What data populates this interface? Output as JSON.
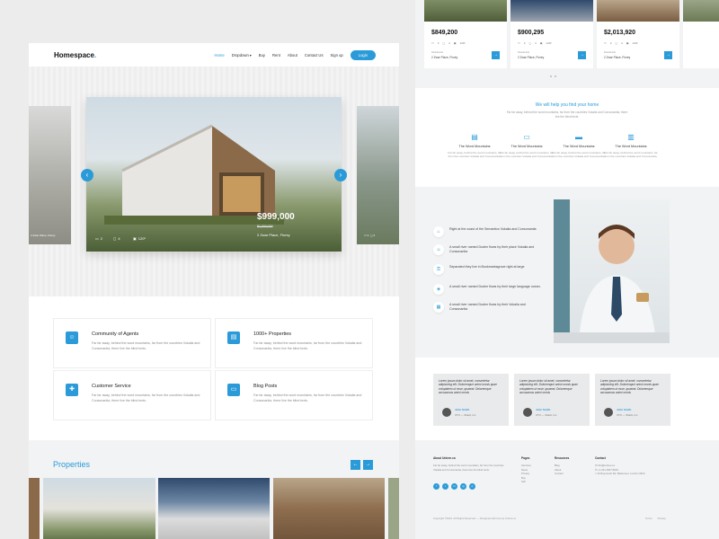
{
  "colors": {
    "accent": "#2a9bd8",
    "text": "#222222",
    "muted": "#888888",
    "band": "#f2f3f4"
  },
  "nav": {
    "logo": "Homespace",
    "logo_dot": ".",
    "items": [
      {
        "label": "Home",
        "active": true
      },
      {
        "label": "Dropdown",
        "caret": true
      },
      {
        "label": "Buy"
      },
      {
        "label": "Rent"
      },
      {
        "label": "About"
      },
      {
        "label": "Contact Us"
      },
      {
        "label": "Sign up"
      }
    ],
    "login": "Login"
  },
  "hero": {
    "price": "$999,000",
    "old_price": "$1,000,000",
    "address": "2 Zwar Place, Florey",
    "beds": "2",
    "baths": "4",
    "area": "120²",
    "prev_icon": "chevron-left-icon",
    "next_icon": "chevron-right-icon"
  },
  "services": [
    {
      "title": "Community of Agents",
      "text": "Far far away, behind the word mountains, far from the countries Vokalia and Consonantia, there live the blind texts.",
      "icon": "people-icon"
    },
    {
      "title": "1000+ Properties",
      "text": "Far far away, behind the word mountains, far from the countries Vokalia and Consonantia, there live the blind texts.",
      "icon": "building-icon"
    },
    {
      "title": "Customer Service",
      "text": "Far far away, behind the word mountains, far from the countries Vokalia and Consonantia, there live the blind texts.",
      "icon": "lifebuoy-icon"
    },
    {
      "title": "Blog Posts",
      "text": "Far far away, behind the word mountains, far from the countries Vokalia and Consonantia, there live the blind texts.",
      "icon": "chat-icon"
    }
  ],
  "properties": {
    "title": "Properties"
  },
  "listings": [
    {
      "price": "$849,200",
      "beds": "2",
      "baths": "4",
      "area": "120²",
      "small": "Residential",
      "address": "2 Zwar Place, Florey"
    },
    {
      "price": "$900,295",
      "beds": "2",
      "baths": "4",
      "area": "120²",
      "small": "Residential",
      "address": "2 Zwar Place, Florey"
    },
    {
      "price": "$2,013,920",
      "beds": "2",
      "baths": "4",
      "area": "120²",
      "small": "Residential",
      "address": "2 Zwar Place, Florey"
    }
  ],
  "help": {
    "title": "We will help you find your home",
    "subtitle": "Far far away, behind the word mountains, far from the countries Vokalia and Consonantia, there live the blind texts.",
    "cols": [
      {
        "title": "The Word Mountains",
        "text": "Far far away, behind the word mountains, far from the countries Vokalia and Consonantia.",
        "icon": "document-icon"
      },
      {
        "title": "The Word Mountains",
        "text": "Far far away, behind the word mountains, far from the countries Vokalia and Consonantia.",
        "icon": "couch-icon"
      },
      {
        "title": "The Word Mountains",
        "text": "Far far away, behind the word mountains, far from the countries Vokalia and Consonantia.",
        "icon": "bed-icon"
      },
      {
        "title": "The Word Mountains",
        "text": "Far far away, behind the word mountains, far from the countries Vokalia and Consonantia.",
        "icon": "building-icon"
      }
    ]
  },
  "agent_features": [
    {
      "text": "Right at the coast of the Semantics Vokalia and Consonantia",
      "icon": "home-icon"
    },
    {
      "text": "A small river named Duden flows by their place Vokalia and Consonantia",
      "icon": "people-icon"
    },
    {
      "text": "Separated they live in Bookmarksgrove right at large",
      "icon": "key-icon"
    },
    {
      "text": "A small river named Duden flows by their large language ocean.",
      "icon": "map-icon"
    },
    {
      "text": "A small river named Duden flows by their Vokalia and Consonantia",
      "icon": "chart-icon"
    }
  ],
  "testimonials": [
    {
      "quote": "Lorem ipsum dolor sit amet, consectetur adipisicing elit. Doloremque animi omnis quae voluptatem ut esse, quaerat. Doloremque accusamus animi omnis",
      "name": "John Smith",
      "role": "CTO — Shack, Inc."
    },
    {
      "quote": "Lorem ipsum dolor sit amet, consectetur adipisicing elit. Doloremque animi omnis quae voluptatem ut esse, quaerat. Doloremque accusamus animi omnis",
      "name": "John Smith",
      "role": "CTO — Shack, Inc."
    },
    {
      "quote": "Lorem ipsum dolor sit amet, consectetur adipisicing elit. Doloremque animi omnis quae voluptatem ut esse, quaerat. Doloremque accusamus animi omnis",
      "name": "John Smith",
      "role": "CTO — Shack, Inc."
    }
  ],
  "footer": {
    "about_title": "About Untree.co",
    "about_text": "Far far away, behind the word mountains, far from the countries Vokalia and Consonantia, there live the blind texts.",
    "pages_title": "Pages",
    "pages": [
      "Services",
      "News",
      "Privacy",
      "Buy",
      "Sell"
    ],
    "resources_title": "Resources",
    "resources": [
      "Blog",
      "About",
      "Contact"
    ],
    "contact_title": "Contact",
    "contact": [
      "info@untree.co",
      "+1 231 4567 8919",
      "43 Raymouth Rd. Baltemoer, London 3910"
    ],
    "social": [
      "f",
      "t",
      "in",
      "ig",
      "p"
    ],
    "copyright": "Copyright ©2021. All Rights Reserved. — Designed with love by Untree.co",
    "legal": [
      "Terms",
      "Privacy"
    ]
  }
}
